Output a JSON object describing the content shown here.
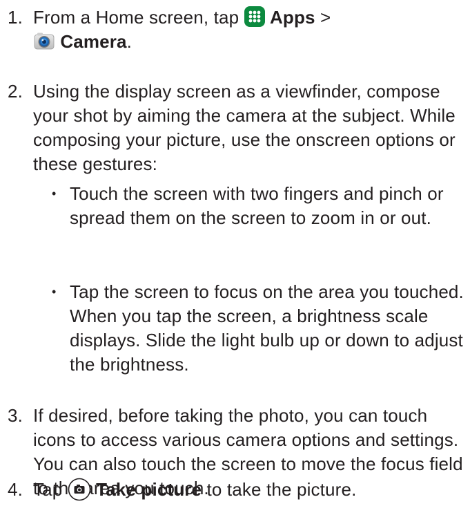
{
  "steps": {
    "s1": {
      "num": "1.",
      "line1_prefix": "From a Home screen, tap ",
      "apps_label": "Apps",
      "sep": " >",
      "camera_label": "Camera",
      "end": "."
    },
    "s2": {
      "num": "2.",
      "text": "Using the display screen as a viewfinder, compose your shot by aiming the camera at the subject. While composing your picture, use the onscreen options or these gestures:",
      "bullets": [
        "Touch the screen with two fingers and pinch or spread them on the screen to zoom in or out.",
        "Tap the screen to focus on the area you touched. When you tap the screen, a brightness scale displays. Slide the light bulb up or down to adjust the brightness."
      ]
    },
    "s3": {
      "num": "3.",
      "text": "If desired, before taking the photo, you can touch icons to access various camera options and settings. You can also touch the screen to move the focus field to the area you touch."
    },
    "s4": {
      "num": "4.",
      "prefix": "Tap ",
      "take_label": "Take picture",
      "suffix": " to take the picture."
    }
  },
  "bullet_glyph": "•",
  "icons": {
    "apps": "apps-grid-icon",
    "camera": "camera-app-icon",
    "shutter": "take-picture-icon"
  },
  "colors": {
    "text": "#231f20",
    "apps_icon_bg": "#0c8a3f"
  }
}
